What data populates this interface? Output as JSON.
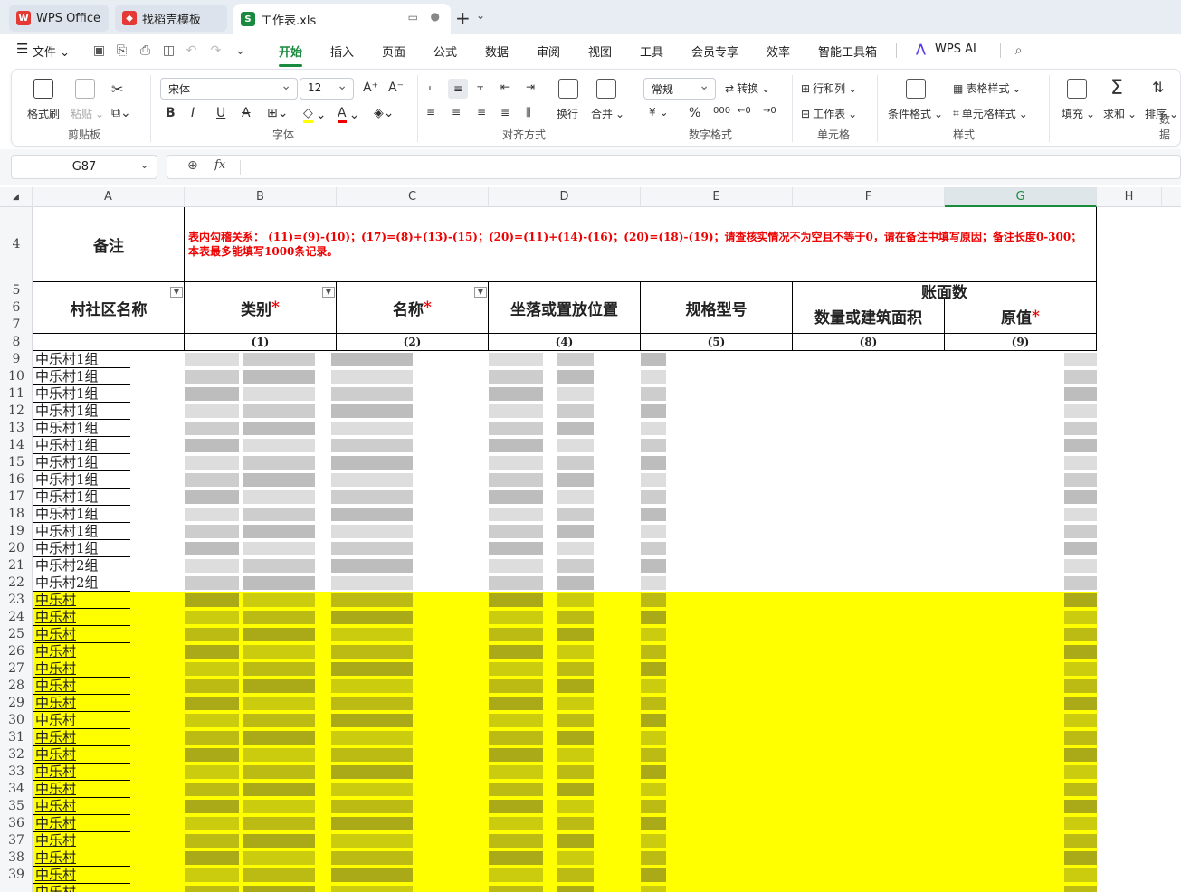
{
  "tabs": [
    {
      "label": "WPS Office",
      "icon": "wps-logo-icon"
    },
    {
      "label": "找稻壳模板",
      "icon": "docer-icon"
    },
    {
      "label": "工作表.xls",
      "icon": "spreadsheet-icon"
    }
  ],
  "menu": {
    "file": "文件",
    "items": [
      "开始",
      "插入",
      "页面",
      "公式",
      "数据",
      "审阅",
      "视图",
      "工具",
      "会员专享",
      "效率",
      "智能工具箱"
    ],
    "ai": "WPS AI"
  },
  "ribbon": {
    "clipboard": {
      "group": "剪贴板",
      "format_painter": "格式刷",
      "paste": "粘贴"
    },
    "font": {
      "group": "字体",
      "name": "宋体",
      "size": "12"
    },
    "align": {
      "group": "对齐方式",
      "wrap": "换行",
      "merge": "合并"
    },
    "number": {
      "group": "数字格式",
      "format": "常规",
      "convert": "转换"
    },
    "cells": {
      "group": "单元格",
      "rowcol": "行和列",
      "sheet": "工作表"
    },
    "styles": {
      "group": "样式",
      "cond": "条件格式",
      "table_style": "表格样式",
      "cell_style": "单元格样式"
    },
    "data": {
      "group": "数据",
      "fill": "填充",
      "sum": "求和",
      "sort": "排序"
    }
  },
  "namebox": "G87",
  "fx": "fx",
  "columns": [
    "A",
    "B",
    "C",
    "D",
    "E",
    "F",
    "G",
    "H"
  ],
  "rows": [
    "4",
    "5",
    "6",
    "7",
    "8",
    "9",
    "10",
    "11",
    "12",
    "13",
    "14",
    "15",
    "16",
    "17",
    "18",
    "19",
    "20",
    "21",
    "22",
    "23",
    "24",
    "25",
    "26",
    "27",
    "28",
    "29",
    "30",
    "31",
    "32",
    "33",
    "34",
    "35",
    "36",
    "37",
    "38",
    "39"
  ],
  "sheet": {
    "remark_label": "备注",
    "remark_text": "表内勾稽关系： (11)=(9)-(10)；(17)=(8)+(13)-(15)；(20)=(11)+(14)-(16)；(20)=(18)-(19)；请查核实情况不为空且不等于0，请在备注中填写原因；备注长度0-300；本表最多能填写1000条记录。",
    "headers": {
      "village": "村社区名称",
      "category": "类别",
      "name": "名称",
      "location": "坐落或置放位置",
      "spec": "规格型号",
      "book": "账面数",
      "qty": "数量或建筑面积",
      "value": "原值",
      "required_mark": "*"
    },
    "index_row": [
      "(1)",
      "(2)",
      "(4)",
      "(5)",
      "(8)",
      "(9)"
    ],
    "villages": [
      "中乐村1组",
      "中乐村1组",
      "中乐村1组",
      "中乐村1组",
      "中乐村1组",
      "中乐村1组",
      "中乐村1组",
      "中乐村1组",
      "中乐村1组",
      "中乐村1组",
      "中乐村1组",
      "中乐村1组",
      "中乐村2组",
      "中乐村2组",
      "中乐村",
      "中乐村",
      "中乐村",
      "中乐村",
      "中乐村",
      "中乐村",
      "中乐村",
      "中乐村",
      "中乐村",
      "中乐村",
      "中乐村",
      "中乐村",
      "中乐村",
      "中乐村",
      "中乐村",
      "中乐村",
      "中乐村",
      "中乐村"
    ]
  },
  "colors": {
    "accent": "#1a8a3f",
    "highlight": "#ffff00",
    "required": "#e00000"
  }
}
